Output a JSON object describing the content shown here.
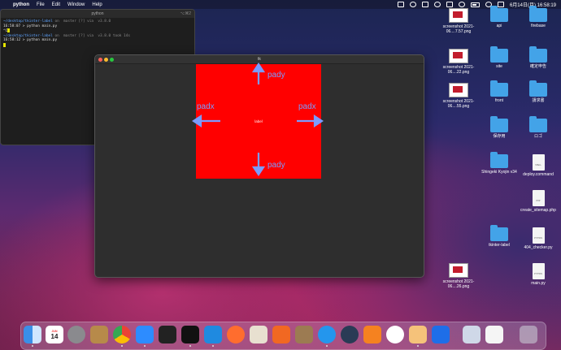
{
  "menubar": {
    "app_name": "python",
    "items": [
      "File",
      "Edit",
      "Window",
      "Help"
    ],
    "datetime": "6月14日(月)  16:58:19"
  },
  "terminal": {
    "title": "python",
    "shortcut": "⌥⌘2",
    "line1_path": "~/desktop/tkinter-label",
    "line1_rest": " on  master [?] via  v3.8.0",
    "line2": "16:58:07 > python main.py",
    "line3": "^C",
    "line4_path": "~/desktop/tkinter-label",
    "line4_rest": " on  master [?] via  v3.8.0 took 14s",
    "line5": "16:58:12 > python main.py"
  },
  "tk_window": {
    "title": "tk",
    "label_text": "label",
    "pady_top": "pady",
    "pady_bottom": "pady",
    "padx_left": "padx",
    "padx_right": "padx"
  },
  "desktop": {
    "icons": [
      {
        "label": "screenshot 2021-06....7.57.png",
        "type": "screenshot"
      },
      {
        "label": "api",
        "type": "folder"
      },
      {
        "label": "firebase",
        "type": "folder"
      },
      {
        "label": "screenshot 2021-06....22.png",
        "type": "screenshot"
      },
      {
        "label": "site",
        "type": "folder"
      },
      {
        "label": "確定申告",
        "type": "folder"
      },
      {
        "label": "screenshot 2021-06....55.png",
        "type": "screenshot"
      },
      {
        "label": "front",
        "type": "folder"
      },
      {
        "label": "請求書",
        "type": "folder"
      },
      {
        "label": "保存用",
        "type": "folder"
      },
      {
        "label": "ロゴ",
        "type": "folder"
      },
      {
        "label": "Shingeki Kyojin v34",
        "type": "folder"
      },
      {
        "label": "deploy.command",
        "type": "doc",
        "tag": "SHELL"
      },
      {
        "label": "create_sitemap.php",
        "type": "doc",
        "tag": "PHP"
      },
      {
        "label": "tkinter-label",
        "type": "folder"
      },
      {
        "label": "404_checker.py",
        "type": "doc",
        "tag": "PYTHON"
      },
      {
        "label": "screenshot 2021-06....26.png",
        "type": "screenshot"
      },
      {
        "label": "main.py",
        "type": "doc",
        "tag": "PYTHON"
      }
    ]
  },
  "dock": {
    "calendar_month": "JUN",
    "calendar_day": "14",
    "apps": [
      "finder-icon",
      "calendar-icon",
      "system-preferences-icon",
      "archive-icon",
      "chrome-icon",
      "zoom-icon",
      "terminal-icon",
      "iterm-icon",
      "vscode-icon",
      "safari-icon",
      "sequel-icon",
      "activity-icon",
      "package-icon",
      "docker-icon",
      "qreate-icon",
      "sourcetree-icon",
      "proxyman-icon",
      "python-launcher-icon",
      "infinity-icon",
      "preview-icon",
      "document-icon",
      "trash-icon"
    ]
  }
}
